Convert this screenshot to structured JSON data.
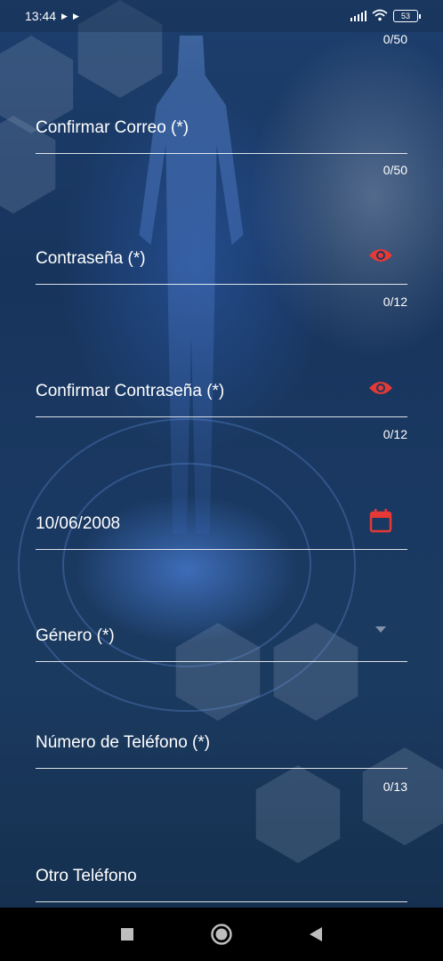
{
  "status_bar": {
    "time": "13:44",
    "battery": "53"
  },
  "form": {
    "email_counter": "0/50",
    "confirm_email": {
      "label": "Confirmar Correo (*)",
      "counter": "0/50"
    },
    "password": {
      "label": "Contraseña (*)",
      "counter": "0/12",
      "icon": "eye-icon"
    },
    "confirm_password": {
      "label": "Confirmar Contraseña (*)",
      "counter": "0/12",
      "icon": "eye-icon"
    },
    "birth_date": {
      "value": "10/06/2008",
      "icon": "calendar-icon"
    },
    "gender": {
      "label": "Género (*)",
      "icon": "dropdown-arrow-icon"
    },
    "phone": {
      "label": "Número de Teléfono (*)",
      "counter": "0/13"
    },
    "other_phone": {
      "label": "Otro Teléfono"
    }
  },
  "colors": {
    "accent_icon": "#e53935",
    "text": "#ffffff",
    "underline": "#ffffff",
    "nav_bar": "#000000"
  },
  "nav_bar": {
    "items": [
      "recent-apps-button",
      "home-button",
      "back-button"
    ]
  }
}
